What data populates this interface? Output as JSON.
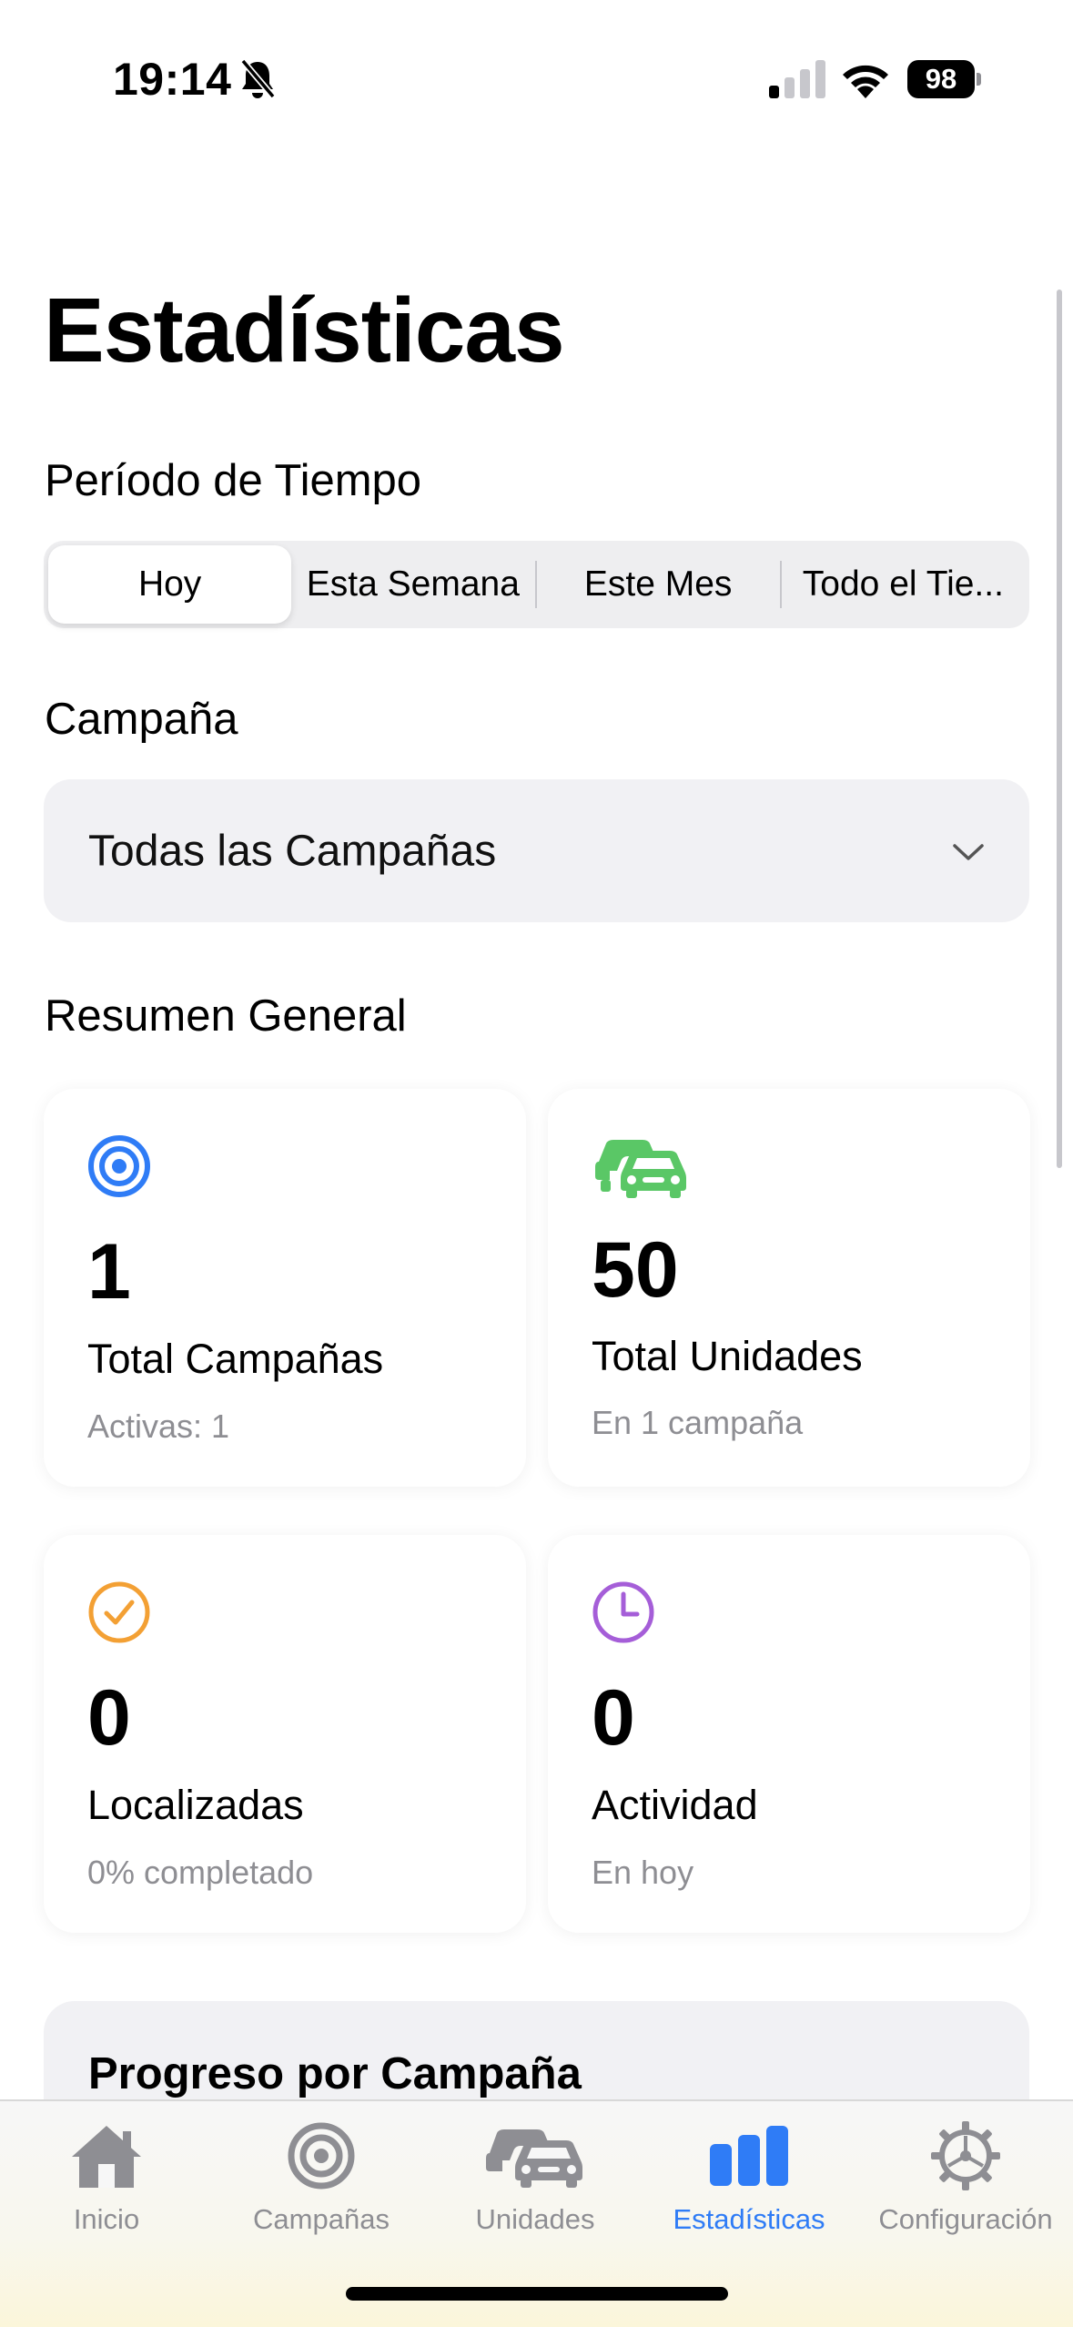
{
  "status_bar": {
    "time": "19:14",
    "battery": "98"
  },
  "page_title": "Estadísticas",
  "period": {
    "label": "Período de Tiempo",
    "options": [
      "Hoy",
      "Esta Semana",
      "Este Mes",
      "Todo el Tie..."
    ],
    "selected": "Hoy"
  },
  "campaign": {
    "label": "Campaña",
    "selected": "Todas las Campañas"
  },
  "summary": {
    "label": "Resumen General",
    "cards": [
      {
        "icon": "target-icon",
        "value": "1",
        "title": "Total Campañas",
        "subtitle": "Activas: 1",
        "color": "#2f7cf6"
      },
      {
        "icon": "cars-icon",
        "value": "50",
        "title": "Total Unidades",
        "subtitle": "En 1 campaña",
        "color": "#5ac766"
      },
      {
        "icon": "checkmark-circle-icon",
        "value": "0",
        "title": "Localizadas",
        "subtitle": "0% completado",
        "color": "#f3a034"
      },
      {
        "icon": "clock-icon",
        "value": "0",
        "title": "Actividad",
        "subtitle": "En hoy",
        "color": "#a55ed8"
      }
    ]
  },
  "progress": {
    "title": "Progreso por Campaña"
  },
  "tab_bar": {
    "tabs": [
      {
        "label": "Inicio",
        "icon": "house-icon"
      },
      {
        "label": "Campañas",
        "icon": "target-icon"
      },
      {
        "label": "Unidades",
        "icon": "cars-icon"
      },
      {
        "label": "Estadísticas",
        "icon": "bar-chart-icon"
      },
      {
        "label": "Configuración",
        "icon": "gear-icon"
      }
    ],
    "active": "Estadísticas"
  },
  "colors": {
    "accent": "#2f7cf6",
    "inactive": "#8e8e93"
  }
}
